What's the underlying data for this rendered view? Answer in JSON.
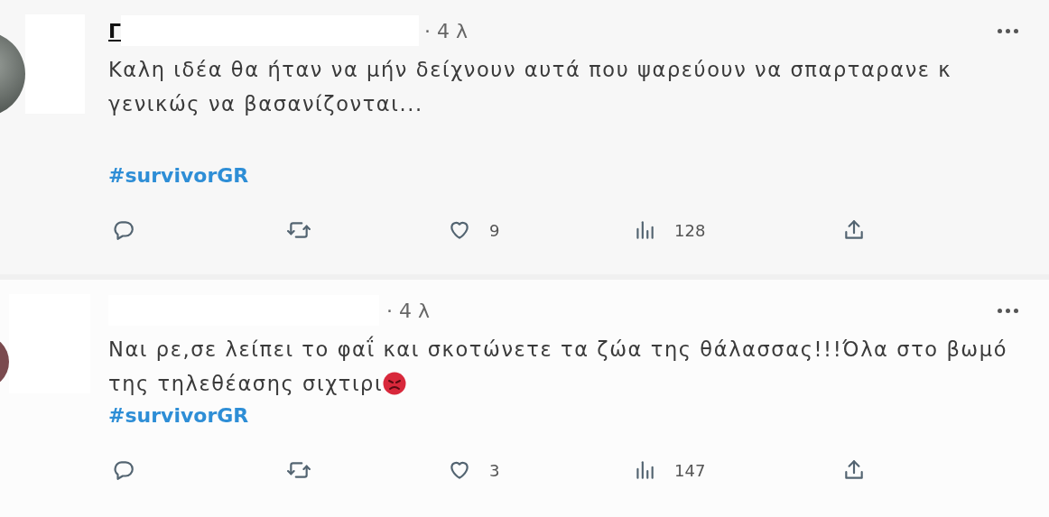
{
  "tweets": [
    {
      "author": "Γ",
      "author_hovered": true,
      "time": "· 4 λ",
      "text": "Καλη ιδέα θα ήταν να μήν δείχνουν αυτά που ψαρεύουν να σπαρταρανε κ γενικώς να βασανίζονται...",
      "emoji": false,
      "hashtag": "#survivorGR",
      "likes": "9",
      "views": "128",
      "shaded": true
    },
    {
      "time": "· 4 λ",
      "text": "Ναι ρε,σε λείπει το φαΐ και σκοτώνετε τα ζώα της θάλασσας!!!Όλα στο βωμό της τηλεθέασης σιχτιρι",
      "emoji": true,
      "hashtag": "#survivorGR",
      "likes": "3",
      "views": "147",
      "shaded": false
    }
  ]
}
